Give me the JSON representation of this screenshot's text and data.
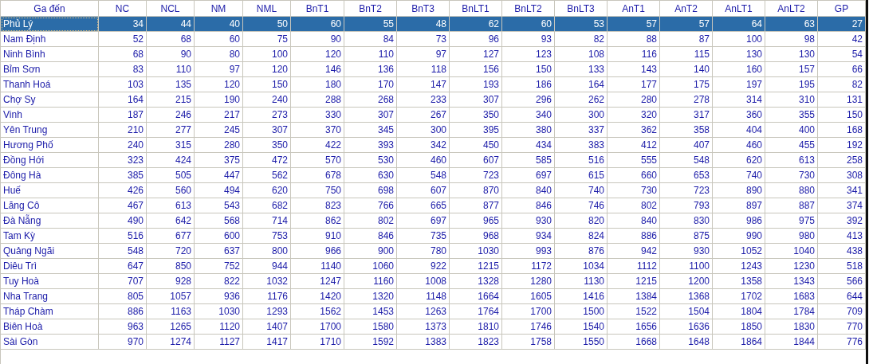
{
  "table": {
    "columns": [
      "Ga đến",
      "NC",
      "NCL",
      "NM",
      "NML",
      "BnT1",
      "BnT2",
      "BnT3",
      "BnLT1",
      "BnLT2",
      "BnLT3",
      "AnT1",
      "AnT2",
      "AnLT1",
      "AnLT2",
      "GP"
    ],
    "rows": [
      {
        "selected": true,
        "cells": [
          "Phủ Lý",
          "34",
          "44",
          "40",
          "50",
          "60",
          "55",
          "48",
          "62",
          "60",
          "53",
          "57",
          "57",
          "64",
          "63",
          "27"
        ]
      },
      {
        "selected": false,
        "cells": [
          "Nam Định",
          "52",
          "68",
          "60",
          "75",
          "90",
          "84",
          "73",
          "96",
          "93",
          "82",
          "88",
          "87",
          "100",
          "98",
          "42"
        ]
      },
      {
        "selected": false,
        "cells": [
          "Ninh Bình",
          "68",
          "90",
          "80",
          "100",
          "120",
          "110",
          "97",
          "127",
          "123",
          "108",
          "116",
          "115",
          "130",
          "130",
          "54"
        ]
      },
      {
        "selected": false,
        "cells": [
          "Bỉm Sơn",
          "83",
          "110",
          "97",
          "120",
          "146",
          "136",
          "118",
          "156",
          "150",
          "133",
          "143",
          "140",
          "160",
          "157",
          "66"
        ]
      },
      {
        "selected": false,
        "cells": [
          "Thanh Hoá",
          "103",
          "135",
          "120",
          "150",
          "180",
          "170",
          "147",
          "193",
          "186",
          "164",
          "177",
          "175",
          "197",
          "195",
          "82"
        ]
      },
      {
        "selected": false,
        "cells": [
          "Chợ Sy",
          "164",
          "215",
          "190",
          "240",
          "288",
          "268",
          "233",
          "307",
          "296",
          "262",
          "280",
          "278",
          "314",
          "310",
          "131"
        ]
      },
      {
        "selected": false,
        "cells": [
          "Vinh",
          "187",
          "246",
          "217",
          "273",
          "330",
          "307",
          "267",
          "350",
          "340",
          "300",
          "320",
          "317",
          "360",
          "355",
          "150"
        ]
      },
      {
        "selected": false,
        "cells": [
          "Yên Trung",
          "210",
          "277",
          "245",
          "307",
          "370",
          "345",
          "300",
          "395",
          "380",
          "337",
          "362",
          "358",
          "404",
          "400",
          "168"
        ]
      },
      {
        "selected": false,
        "cells": [
          "Hương Phố",
          "240",
          "315",
          "280",
          "350",
          "422",
          "393",
          "342",
          "450",
          "434",
          "383",
          "412",
          "407",
          "460",
          "455",
          "192"
        ]
      },
      {
        "selected": false,
        "cells": [
          "Đồng Hới",
          "323",
          "424",
          "375",
          "472",
          "570",
          "530",
          "460",
          "607",
          "585",
          "516",
          "555",
          "548",
          "620",
          "613",
          "258"
        ]
      },
      {
        "selected": false,
        "cells": [
          "Đông Hà",
          "385",
          "505",
          "447",
          "562",
          "678",
          "630",
          "548",
          "723",
          "697",
          "615",
          "660",
          "653",
          "740",
          "730",
          "308"
        ]
      },
      {
        "selected": false,
        "cells": [
          "Huế",
          "426",
          "560",
          "494",
          "620",
          "750",
          "698",
          "607",
          "870",
          "840",
          "740",
          "730",
          "723",
          "890",
          "880",
          "341"
        ]
      },
      {
        "selected": false,
        "cells": [
          "Lăng Cô",
          "467",
          "613",
          "543",
          "682",
          "823",
          "766",
          "665",
          "877",
          "846",
          "746",
          "802",
          "793",
          "897",
          "887",
          "374"
        ]
      },
      {
        "selected": false,
        "cells": [
          "Đà Nẵng",
          "490",
          "642",
          "568",
          "714",
          "862",
          "802",
          "697",
          "965",
          "930",
          "820",
          "840",
          "830",
          "986",
          "975",
          "392"
        ]
      },
      {
        "selected": false,
        "cells": [
          "Tam Kỳ",
          "516",
          "677",
          "600",
          "753",
          "910",
          "846",
          "735",
          "968",
          "934",
          "824",
          "886",
          "875",
          "990",
          "980",
          "413"
        ]
      },
      {
        "selected": false,
        "cells": [
          "Quảng Ngãi",
          "548",
          "720",
          "637",
          "800",
          "966",
          "900",
          "780",
          "1030",
          "993",
          "876",
          "942",
          "930",
          "1052",
          "1040",
          "438"
        ]
      },
      {
        "selected": false,
        "cells": [
          "Diêu Trì",
          "647",
          "850",
          "752",
          "944",
          "1140",
          "1060",
          "922",
          "1215",
          "1172",
          "1034",
          "1112",
          "1100",
          "1243",
          "1230",
          "518"
        ]
      },
      {
        "selected": false,
        "cells": [
          "Tuy Hoà",
          "707",
          "928",
          "822",
          "1032",
          "1247",
          "1160",
          "1008",
          "1328",
          "1280",
          "1130",
          "1215",
          "1200",
          "1358",
          "1343",
          "566"
        ]
      },
      {
        "selected": false,
        "cells": [
          "Nha Trang",
          "805",
          "1057",
          "936",
          "1176",
          "1420",
          "1320",
          "1148",
          "1664",
          "1605",
          "1416",
          "1384",
          "1368",
          "1702",
          "1683",
          "644"
        ]
      },
      {
        "selected": false,
        "cells": [
          "Tháp Chàm",
          "886",
          "1163",
          "1030",
          "1293",
          "1562",
          "1453",
          "1263",
          "1764",
          "1700",
          "1500",
          "1522",
          "1504",
          "1804",
          "1784",
          "709"
        ]
      },
      {
        "selected": false,
        "cells": [
          "Biên Hoà",
          "963",
          "1265",
          "1120",
          "1407",
          "1700",
          "1580",
          "1373",
          "1810",
          "1746",
          "1540",
          "1656",
          "1636",
          "1850",
          "1830",
          "770"
        ]
      },
      {
        "selected": false,
        "cells": [
          "Sài Gòn",
          "970",
          "1274",
          "1127",
          "1417",
          "1710",
          "1592",
          "1383",
          "1823",
          "1758",
          "1550",
          "1668",
          "1648",
          "1864",
          "1844",
          "776"
        ]
      }
    ]
  }
}
